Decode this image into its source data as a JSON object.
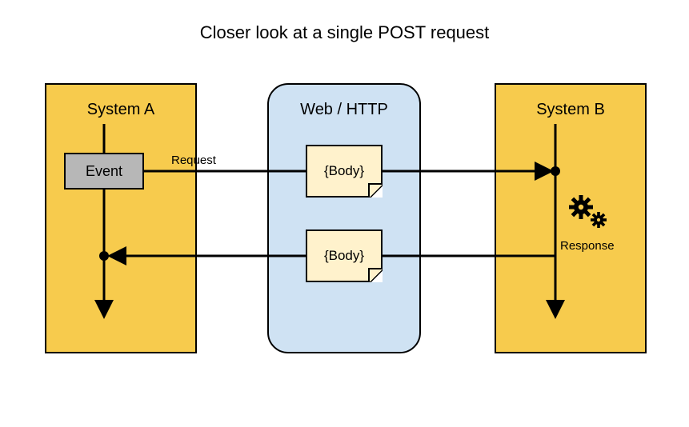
{
  "title": "Closer look at a single POST request",
  "systemA": {
    "label": "System A",
    "event_label": "Event"
  },
  "web": {
    "label": "Web / HTTP",
    "request_body": "{Body}",
    "response_body": "{Body}"
  },
  "systemB": {
    "label": "System B"
  },
  "labels": {
    "request": "Request",
    "response": "Response"
  },
  "colors": {
    "system": "#f7cb4d",
    "web": "#cfe2f3",
    "event": "#b7b7b7",
    "note": "#fff2cc",
    "stroke": "#000000"
  }
}
